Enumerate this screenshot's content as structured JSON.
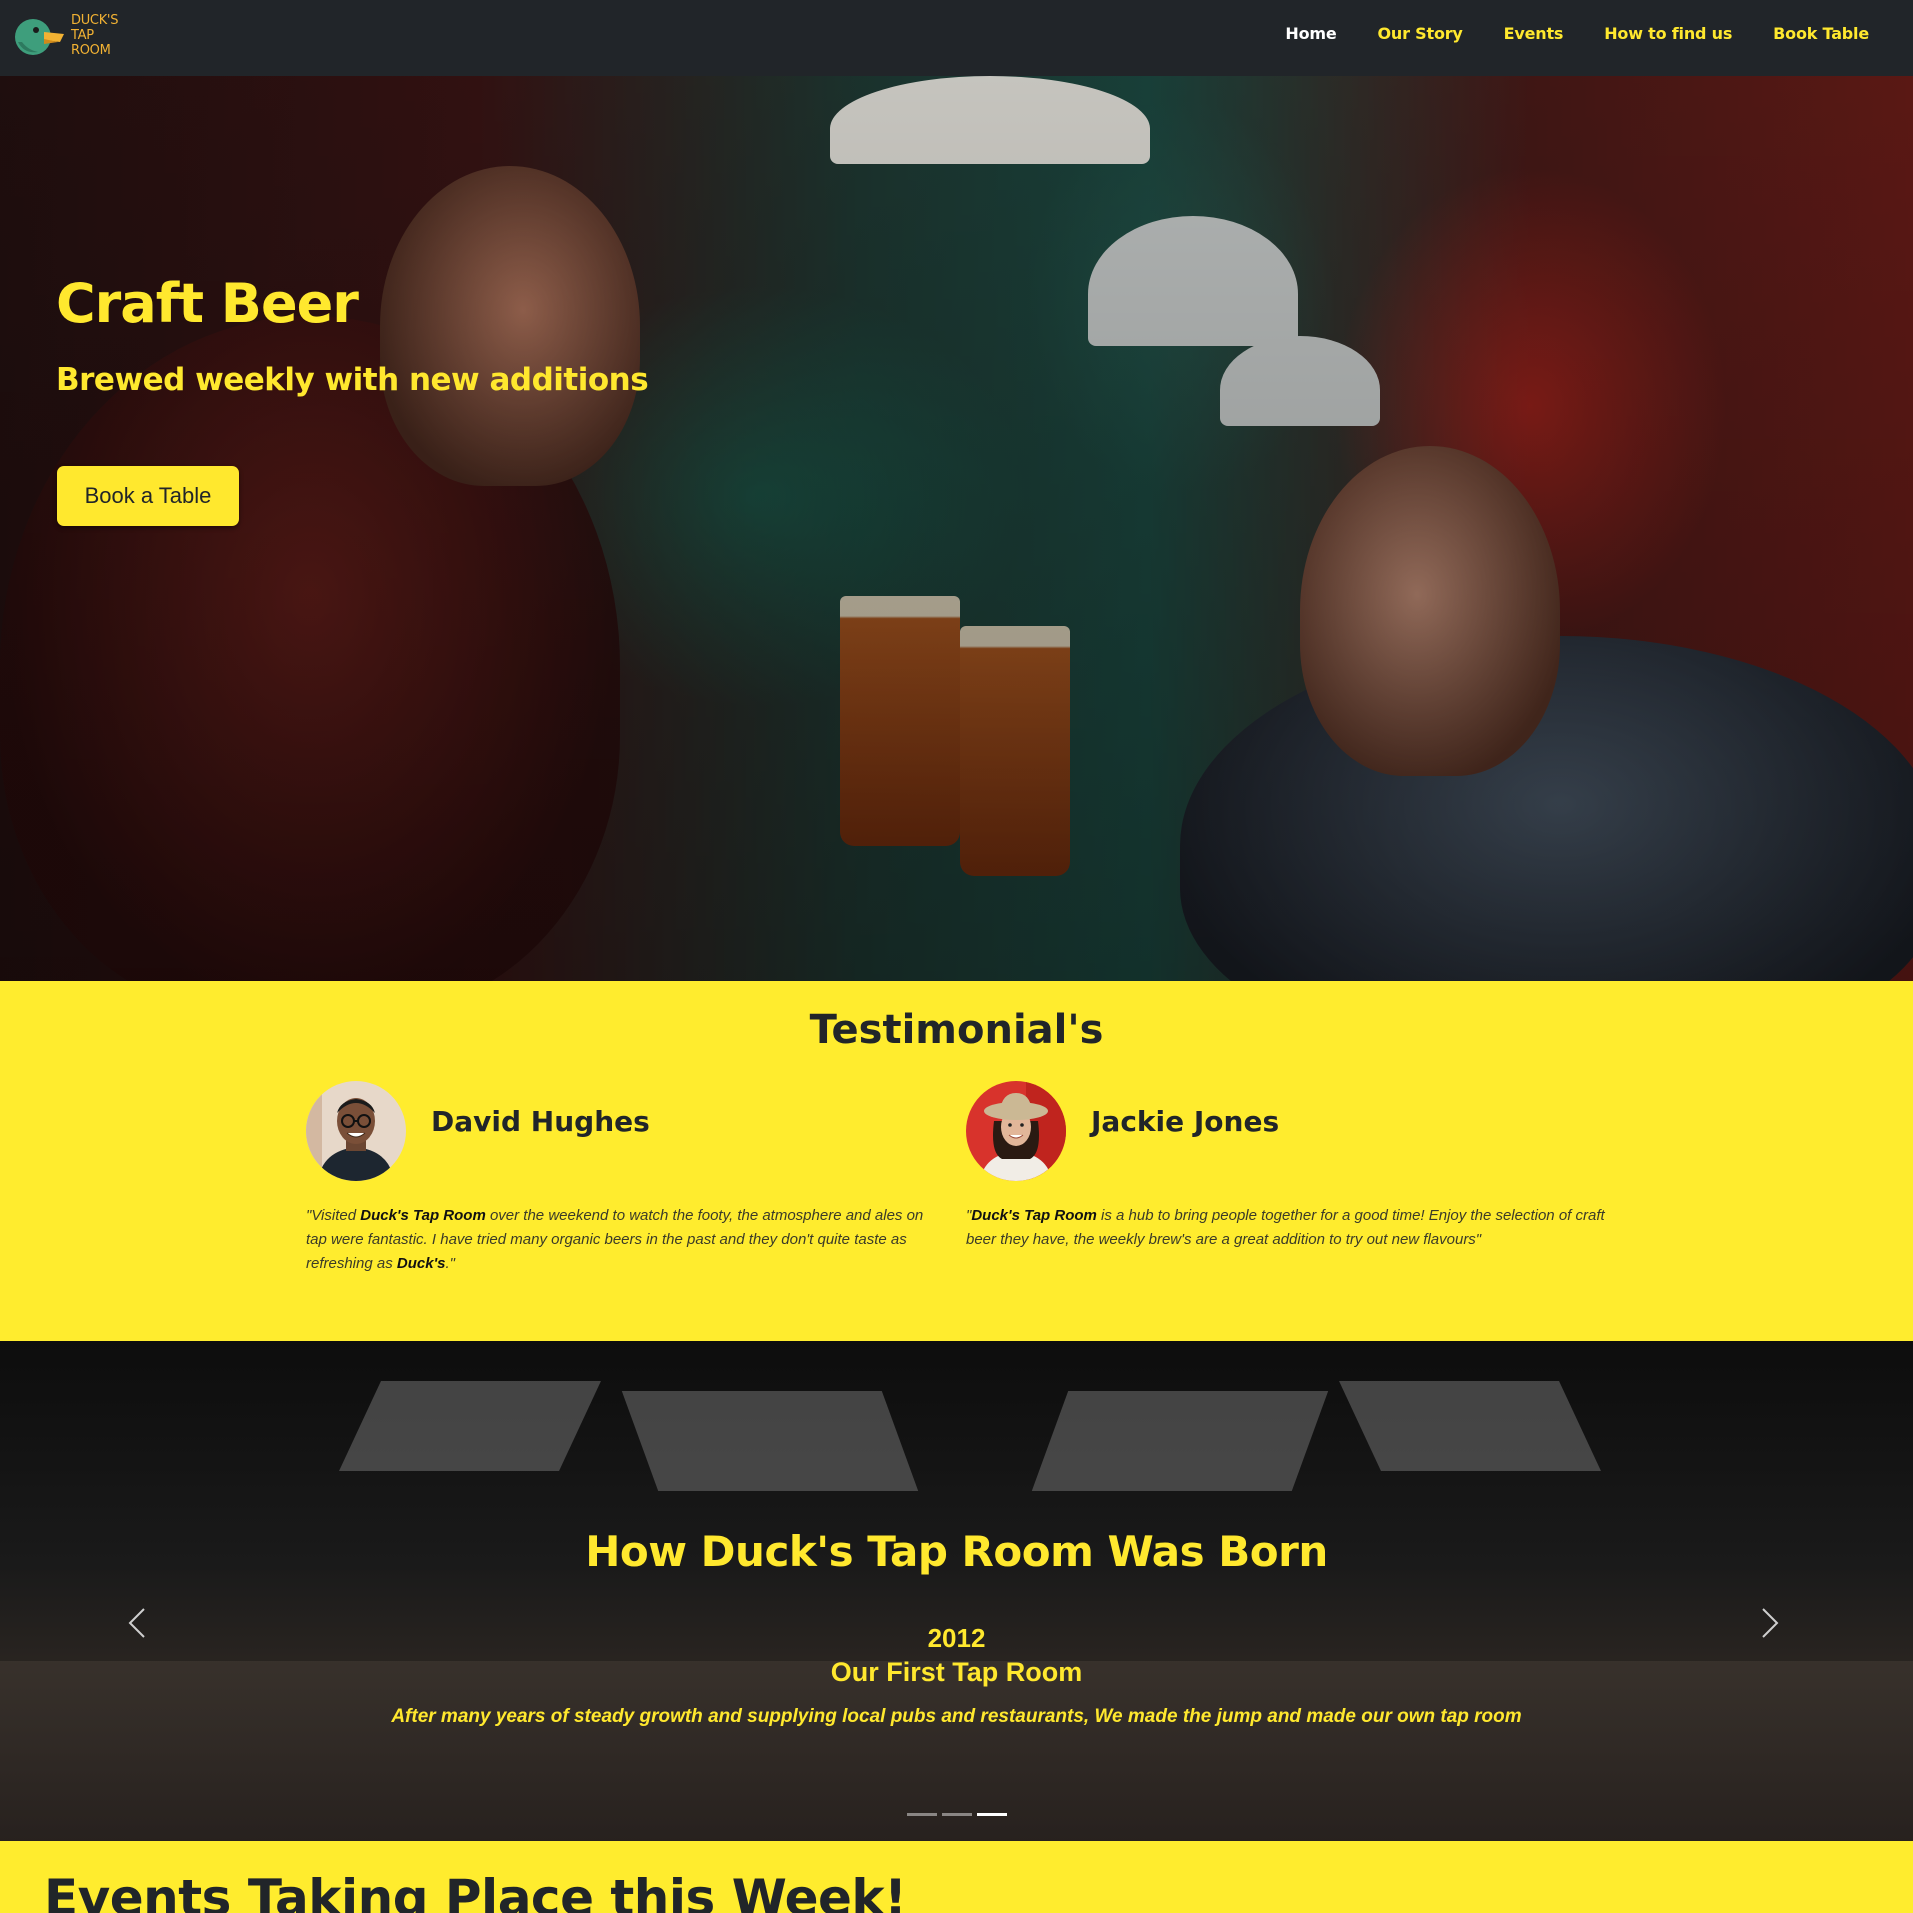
{
  "brand": {
    "logo_lines": [
      "DUCK'S",
      "TAP",
      "ROOM"
    ],
    "accent": "#ffe82e",
    "dark": "#212529"
  },
  "nav": {
    "items": [
      {
        "label": "Home",
        "active": true
      },
      {
        "label": "Our Story"
      },
      {
        "label": "Events"
      },
      {
        "label": "How to find us"
      },
      {
        "label": "Book Table"
      }
    ]
  },
  "hero": {
    "title": "Craft Beer",
    "subtitle": "Brewed weekly with new additions",
    "button": "Book a Table"
  },
  "testimonials": {
    "title": "Testimonial's",
    "items": [
      {
        "name": "David Hughes",
        "quote_parts": [
          "\"Visited ",
          "Duck's Tap Room",
          " over the weekend to watch the footy, the atmosphere and ales on tap were fantastic. I have tried many organic beers in the past and they don't quite taste as refreshing as ",
          "Duck's",
          ".\""
        ]
      },
      {
        "name": "Jackie Jones",
        "quote_parts": [
          "\"",
          "Duck's Tap Room",
          " is a hub to bring people together for a good time! Enjoy the selection of craft beer they have, the weekly brew's are a great addition to try out new flavours\""
        ]
      }
    ]
  },
  "story": {
    "title": "How Duck's Tap Room Was Born",
    "slide": {
      "year": "2012",
      "heading": "Our First Tap Room",
      "text": "After many years of steady growth and supplying local pubs and restaurants, We made the jump and made our own tap room"
    },
    "prev_icon": "chevron-left-icon",
    "next_icon": "chevron-right-icon",
    "slide_count": 3,
    "active_slide": 3
  },
  "events": {
    "title": "Events Taking Place this Week!"
  }
}
